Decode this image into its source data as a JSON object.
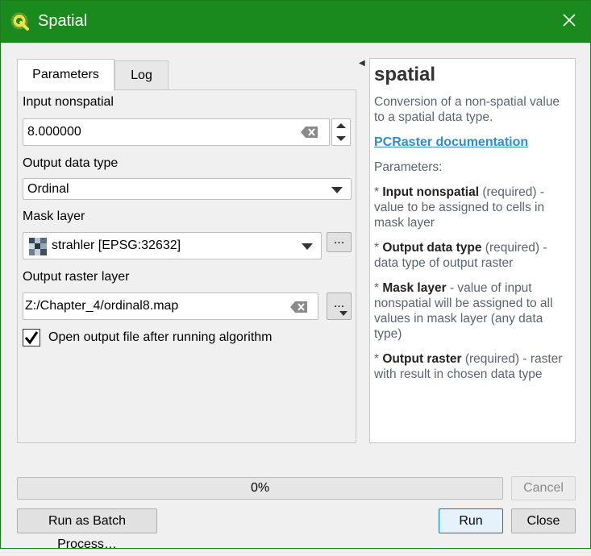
{
  "window": {
    "title": "Spatial",
    "close_label": "✕"
  },
  "tabs": [
    {
      "label": "Parameters"
    },
    {
      "label": "Log"
    }
  ],
  "params": {
    "input_nonspatial": {
      "label": "Input nonspatial",
      "value": "8.000000"
    },
    "output_type": {
      "label": "Output data type",
      "value": "Ordinal"
    },
    "mask_layer": {
      "label": "Mask layer",
      "value": "strahler [EPSG:32632]",
      "browse": "..."
    },
    "output_raster": {
      "label": "Output raster layer",
      "value": "Z:/Chapter_4/ordinal8.map",
      "browse": "..."
    },
    "open_output": {
      "label": "Open output file after running algorithm",
      "checked": true
    }
  },
  "help": {
    "title": "spatial",
    "description": "Conversion of a non-spatial value to a spatial data type.",
    "doc_link": "PCRaster documentation",
    "params_heading": "Parameters:",
    "items": [
      {
        "name": "Input nonspatial",
        "req": "(required) -",
        "desc": "value to be assigned to cells in mask layer"
      },
      {
        "name": "Output data type",
        "req": "(required) -",
        "desc": "data type of output raster"
      },
      {
        "name": "Mask layer",
        "req": "",
        "desc": "- value of input nonspatial will be assigned to all values in mask layer (any data type)"
      },
      {
        "name": "Output raster",
        "req": "(required) -",
        "desc": "raster with result in chosen data type"
      }
    ]
  },
  "progress": {
    "value": 0,
    "label": "0%"
  },
  "buttons": {
    "cancel": "Cancel",
    "batch": "Run as Batch Process…",
    "run": "Run",
    "close": "Close"
  },
  "colors": {
    "titlebar": "#1a8a1f",
    "link": "#2a8ed0"
  }
}
